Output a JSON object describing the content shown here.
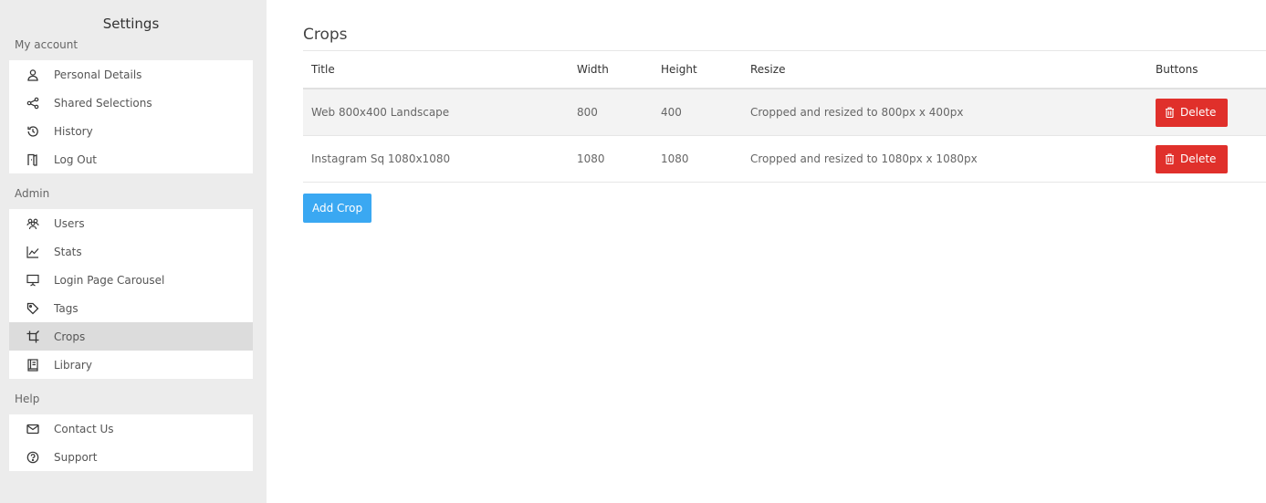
{
  "sidebar": {
    "title": "Settings",
    "sections": [
      {
        "label": "My account",
        "items": [
          {
            "label": "Personal Details",
            "icon": "user-icon"
          },
          {
            "label": "Shared Selections",
            "icon": "share-icon"
          },
          {
            "label": "History",
            "icon": "history-icon"
          },
          {
            "label": "Log Out",
            "icon": "logout-door-icon"
          }
        ]
      },
      {
        "label": "Admin",
        "items": [
          {
            "label": "Users",
            "icon": "users-icon"
          },
          {
            "label": "Stats",
            "icon": "line-chart-icon"
          },
          {
            "label": "Login Page Carousel",
            "icon": "presentation-icon"
          },
          {
            "label": "Tags",
            "icon": "tag-icon"
          },
          {
            "label": "Crops",
            "icon": "crop-icon",
            "active": true
          },
          {
            "label": "Library",
            "icon": "book-icon"
          }
        ]
      },
      {
        "label": "Help",
        "items": [
          {
            "label": "Contact Us",
            "icon": "mail-icon"
          },
          {
            "label": "Support",
            "icon": "help-circle-icon"
          }
        ]
      }
    ]
  },
  "main": {
    "title": "Crops",
    "columns": {
      "title": "Title",
      "width": "Width",
      "height": "Height",
      "resize": "Resize",
      "buttons": "Buttons"
    },
    "rows": [
      {
        "title": "Web 800x400 Landscape",
        "width": "800",
        "height": "400",
        "resize": "Cropped and resized to 800px x 400px",
        "button": "Delete"
      },
      {
        "title": "Instagram Sq 1080x1080",
        "width": "1080",
        "height": "1080",
        "resize": "Cropped and resized to 1080px x 1080px",
        "button": "Delete"
      }
    ],
    "add_button": "Add Crop"
  },
  "colors": {
    "accent": "#3aa8f2",
    "danger": "#e0302b",
    "sidebar_bg": "#ececec",
    "active_item": "#dcdcdc"
  }
}
